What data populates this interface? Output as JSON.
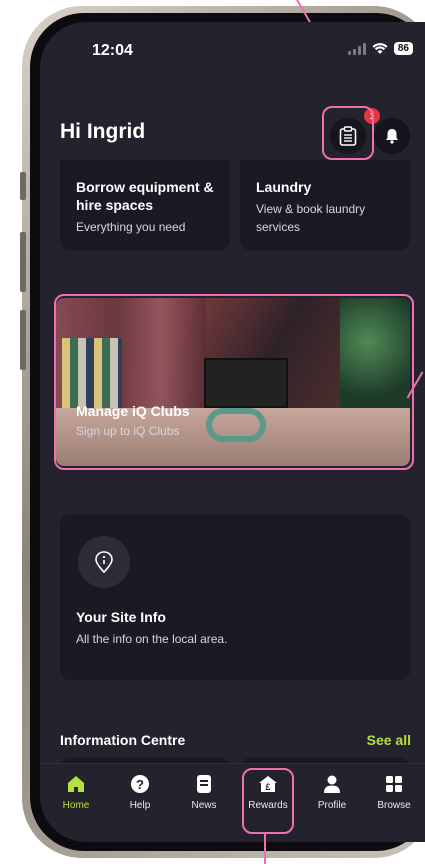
{
  "status_bar": {
    "time": "12:04",
    "battery": "86"
  },
  "header": {
    "greeting": "Hi Ingrid",
    "notification_count": "1"
  },
  "service_cards": [
    {
      "title": "Borrow equipment & hire spaces",
      "subtitle": "Everything you need"
    },
    {
      "title": "Laundry",
      "subtitle": "View & book laundry services"
    }
  ],
  "hero": {
    "title": "Manage iQ Clubs",
    "subtitle": "Sign up to iQ Clubs"
  },
  "site_info": {
    "title": "Your Site Info",
    "subtitle": "All the info on the local area."
  },
  "information_centre": {
    "title": "Information Centre",
    "see_all": "See all"
  },
  "nav": [
    {
      "label": "Home",
      "icon": "home-icon",
      "active": true
    },
    {
      "label": "Help",
      "icon": "help-icon"
    },
    {
      "label": "News",
      "icon": "news-icon"
    },
    {
      "label": "Rewards",
      "icon": "rewards-icon"
    },
    {
      "label": "Profile",
      "icon": "profile-icon"
    },
    {
      "label": "Browse",
      "icon": "browse-icon"
    }
  ],
  "colors": {
    "accent": "#b4e23c",
    "annotation": "#f06fae",
    "background": "#23222d"
  }
}
